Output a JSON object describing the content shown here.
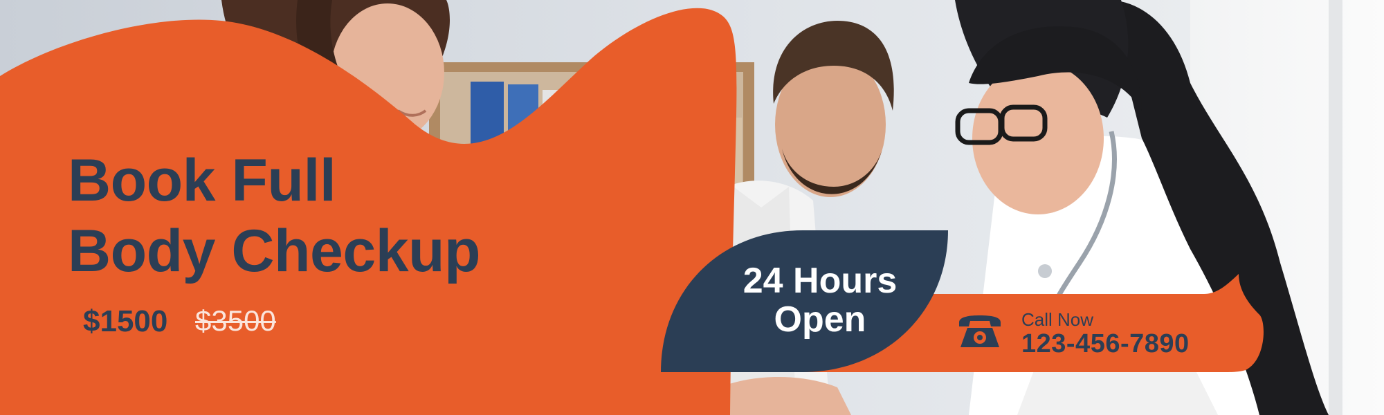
{
  "headline": {
    "line1": "Book Full",
    "line2": "Body Checkup"
  },
  "pricing": {
    "current": "$1500",
    "original": "$3500"
  },
  "hours": {
    "line1": "24 Hours",
    "line2": "Open"
  },
  "contact": {
    "label": "Call Now",
    "phone": "123-456-7890",
    "icon": "telephone-icon"
  },
  "colors": {
    "orange": "#e85d2a",
    "navy": "#2b3e55",
    "white": "#ffffff"
  }
}
